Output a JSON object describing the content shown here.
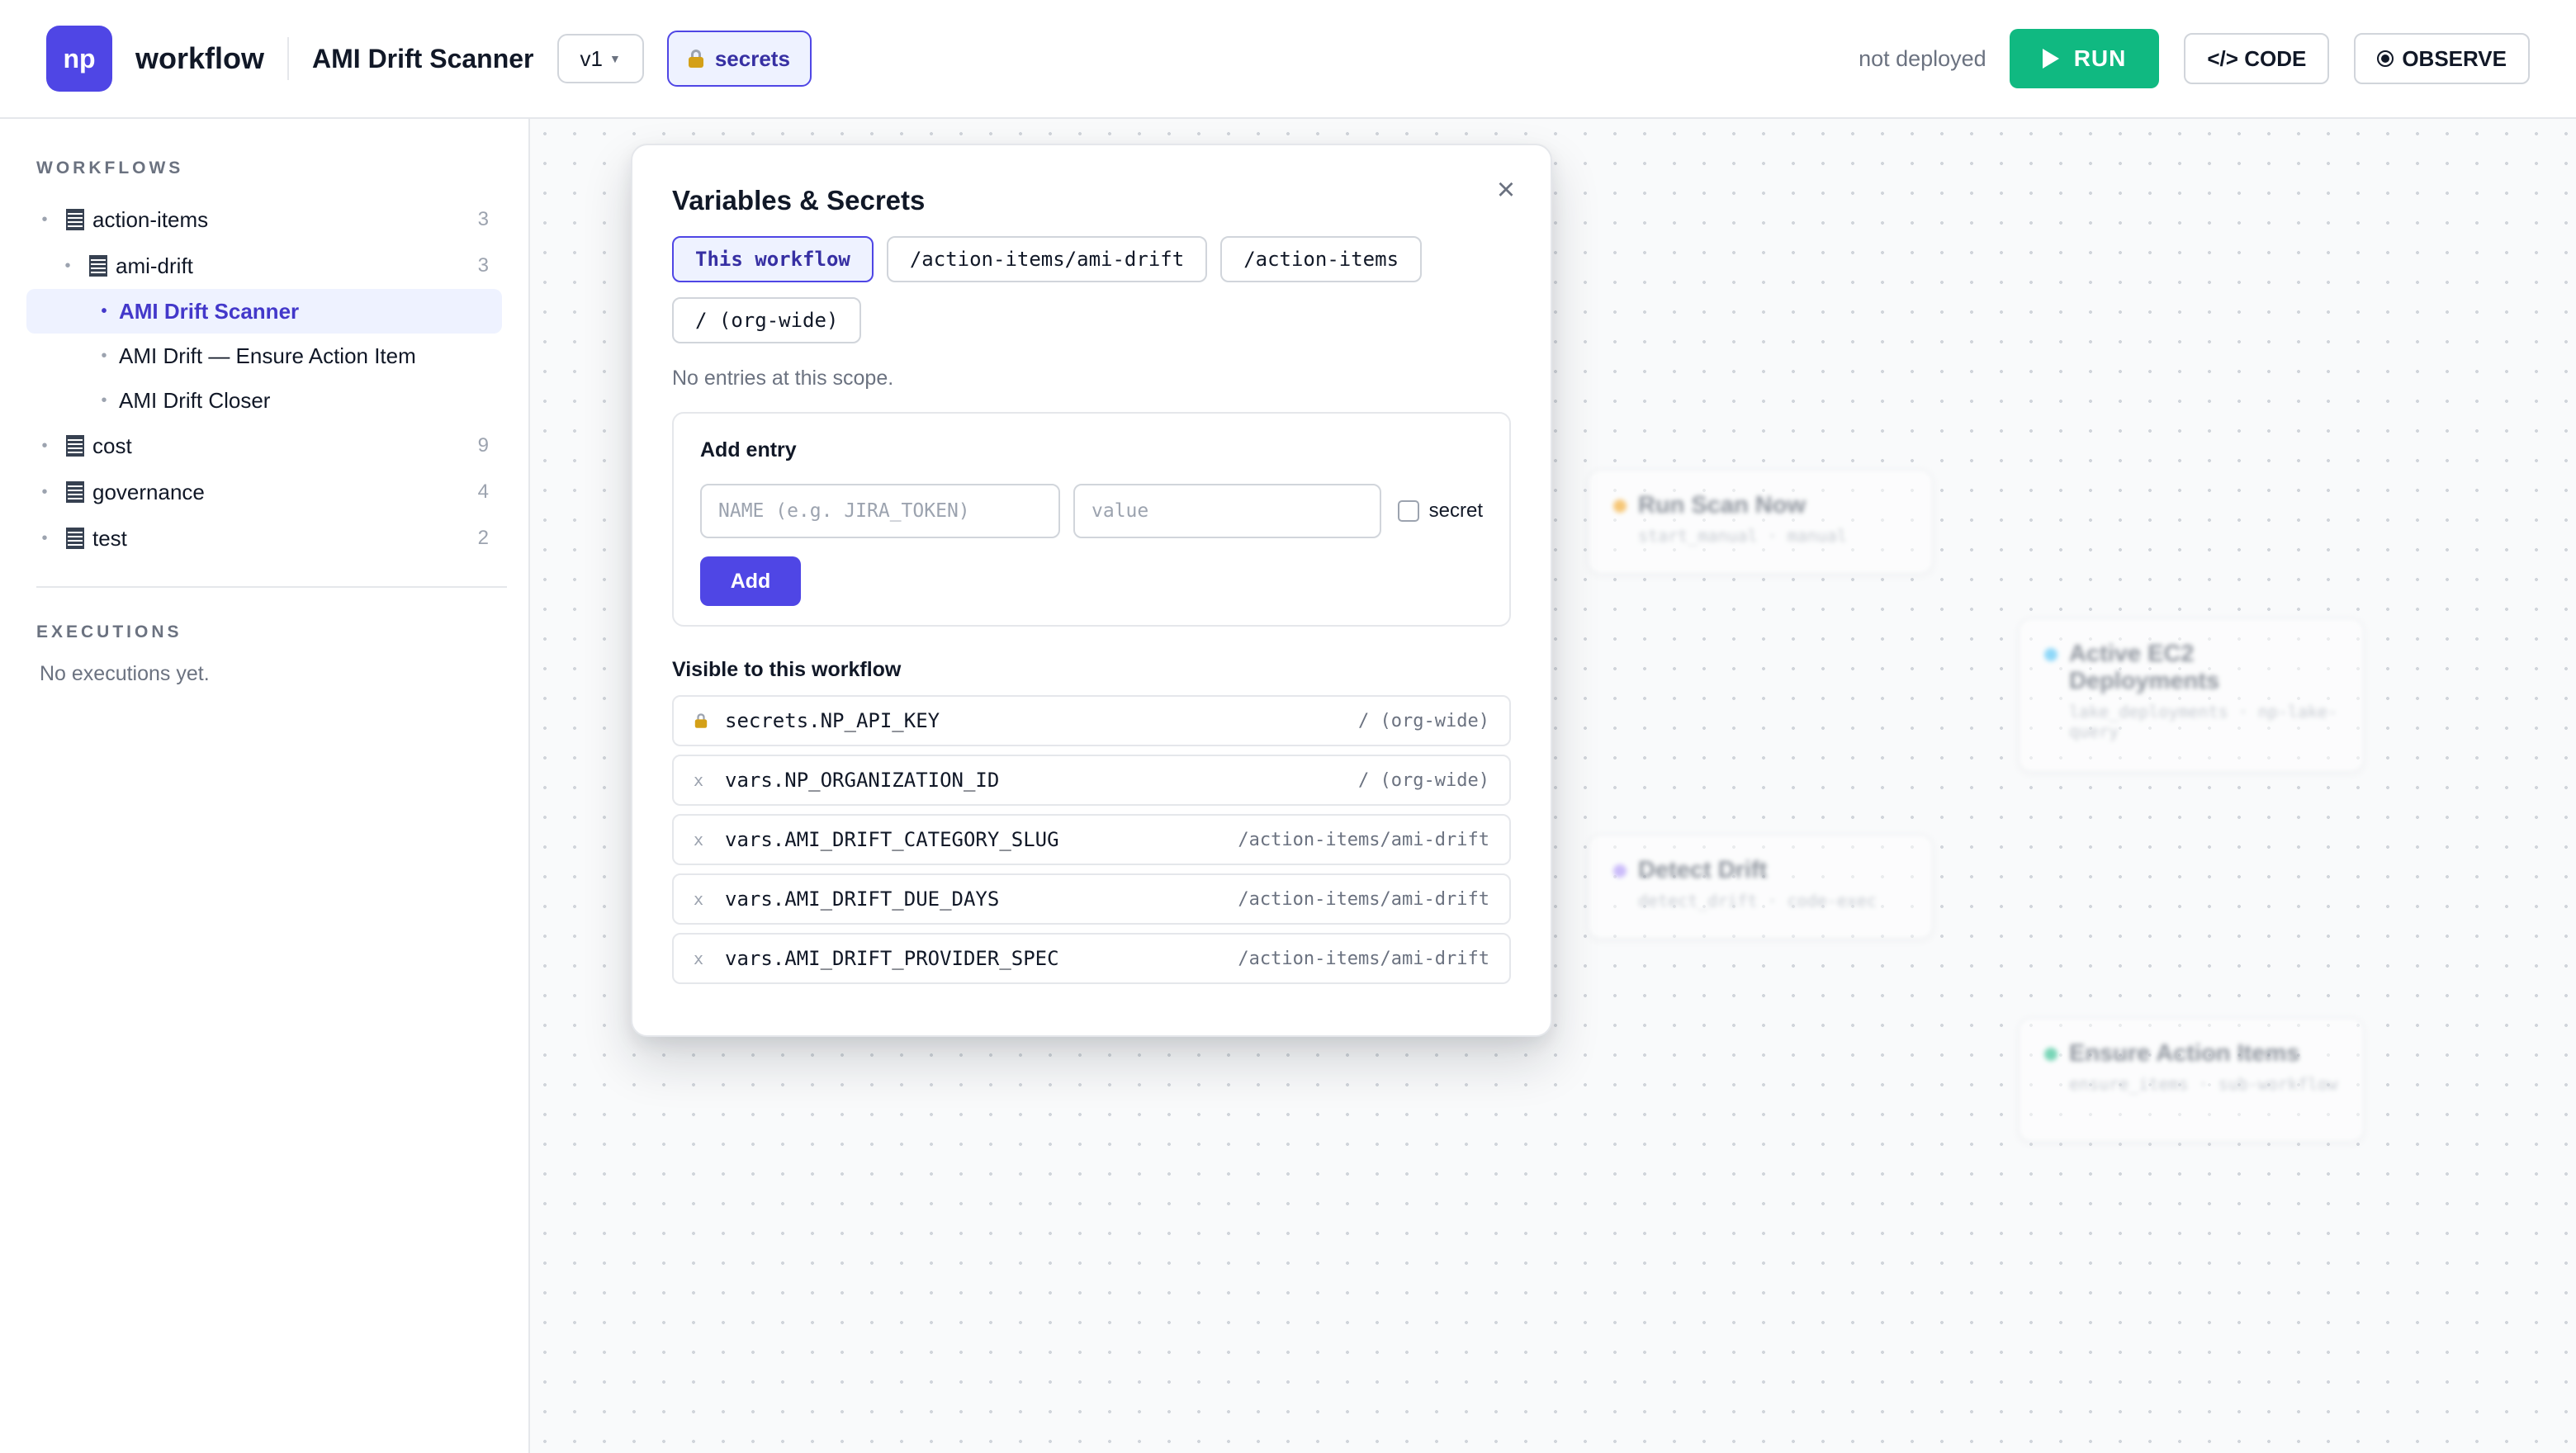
{
  "header": {
    "logo_text": "np",
    "app_name": "workflow",
    "workflow_name": "AMI Drift Scanner",
    "version": "v1",
    "secrets_label": "secrets",
    "deploy_status": "not deployed",
    "run_label": "RUN",
    "code_label": "</> CODE",
    "observe_label": "OBSERVE"
  },
  "sidebar": {
    "workflows_heading": "WORKFLOWS",
    "tree": [
      {
        "label": "action-items",
        "count": "3",
        "level": 0
      },
      {
        "label": "ami-drift",
        "count": "3",
        "level": 1
      },
      {
        "label": "AMI Drift Scanner",
        "count": "",
        "level": 2,
        "active": true
      },
      {
        "label": "AMI Drift — Ensure Action Item",
        "count": "",
        "level": 2
      },
      {
        "label": "AMI Drift Closer",
        "count": "",
        "level": 2
      },
      {
        "label": "cost",
        "count": "9",
        "level": 0
      },
      {
        "label": "governance",
        "count": "4",
        "level": 0
      },
      {
        "label": "test",
        "count": "2",
        "level": 0
      }
    ],
    "executions_heading": "EXECUTIONS",
    "executions_empty": "No executions yet."
  },
  "canvas": {
    "nodes": [
      {
        "title": "Run Scan Now",
        "subtitle": "start_manual · manual",
        "dot_color": "#f59e0b"
      },
      {
        "title": "Active EC2 Deployments",
        "subtitle": "lake_deployments · np-lake-query",
        "dot_color": "#38bdf8"
      },
      {
        "title": "Detect Drift",
        "subtitle": "detect_drift · code-exec",
        "dot_color": "#a78bfa"
      },
      {
        "title": "Ensure Action Items",
        "subtitle": "ensure_items · sub-workflow",
        "dot_color": "#10b981"
      }
    ]
  },
  "modal": {
    "title": "Variables & Secrets",
    "close_icon": "×",
    "scopes": [
      {
        "label": "This workflow",
        "selected": true
      },
      {
        "label": "/action-items/ami-drift",
        "selected": false
      },
      {
        "label": "/action-items",
        "selected": false
      },
      {
        "label": "/ (org-wide)",
        "selected": false
      }
    ],
    "empty_text": "No entries at this scope.",
    "add_entry": {
      "title": "Add entry",
      "name_placeholder": "NAME (e.g. JIRA_TOKEN)",
      "value_placeholder": "value",
      "secret_label": "secret",
      "add_button": "Add"
    },
    "visible_title": "Visible to this workflow",
    "entries": [
      {
        "type": "secret",
        "prefix": "",
        "name": "secrets.NP_API_KEY",
        "scope": "/ (org-wide)"
      },
      {
        "type": "var",
        "prefix": "x",
        "name": "vars.NP_ORGANIZATION_ID",
        "scope": "/ (org-wide)"
      },
      {
        "type": "var",
        "prefix": "x",
        "name": "vars.AMI_DRIFT_CATEGORY_SLUG",
        "scope": "/action-items/ami-drift"
      },
      {
        "type": "var",
        "prefix": "x",
        "name": "vars.AMI_DRIFT_DUE_DAYS",
        "scope": "/action-items/ami-drift"
      },
      {
        "type": "var",
        "prefix": "x",
        "name": "vars.AMI_DRIFT_PROVIDER_SPEC",
        "scope": "/action-items/ami-drift"
      }
    ]
  }
}
